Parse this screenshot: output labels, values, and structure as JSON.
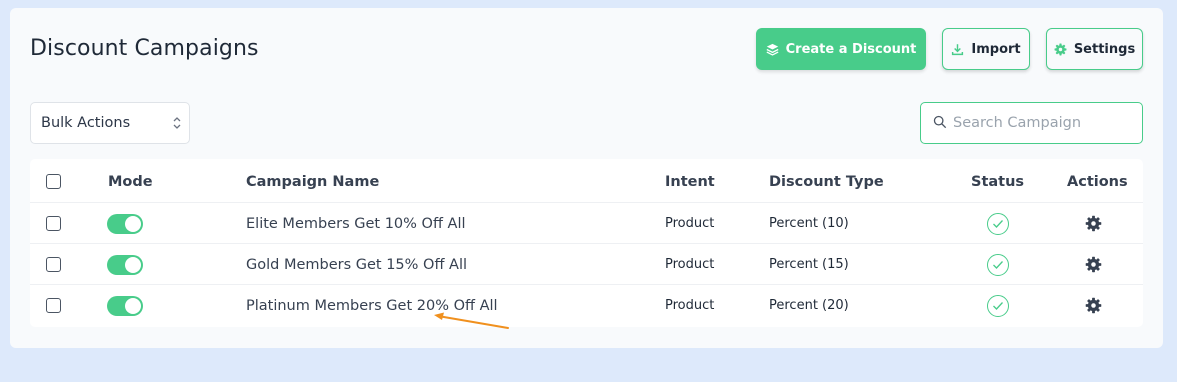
{
  "page": {
    "title": "Discount Campaigns"
  },
  "toolbar": {
    "create_label": "Create a Discount",
    "import_label": "Import",
    "settings_label": "Settings"
  },
  "filters": {
    "bulk_actions_value": "Bulk Actions",
    "search_placeholder": "Search Campaign"
  },
  "table": {
    "columns": {
      "mode": "Mode",
      "campaign_name": "Campaign Name",
      "intent": "Intent",
      "discount_type": "Discount Type",
      "status": "Status",
      "actions": "Actions"
    },
    "rows": [
      {
        "name": "Elite Members Get 10% Off All",
        "intent": "Product",
        "discount_type": "Percent (10)",
        "mode_on": true,
        "status": "active"
      },
      {
        "name": "Gold Members Get 15% Off All",
        "intent": "Product",
        "discount_type": "Percent (15)",
        "mode_on": true,
        "status": "active"
      },
      {
        "name": "Platinum Members Get 20% Off All",
        "intent": "Product",
        "discount_type": "Percent (20)",
        "mode_on": true,
        "status": "active"
      }
    ]
  },
  "icons": {
    "create": "layers-icon",
    "import": "download-icon",
    "settings": "gear-icon",
    "search": "search-icon",
    "status": "check-circle-icon",
    "actions": "gear-icon",
    "select": "chevron-up-down-icon"
  },
  "colors": {
    "accent": "#48cc8a",
    "background": "#dde9fb",
    "panel": "#f8fafc",
    "annotation_arrow": "#f0901e"
  }
}
